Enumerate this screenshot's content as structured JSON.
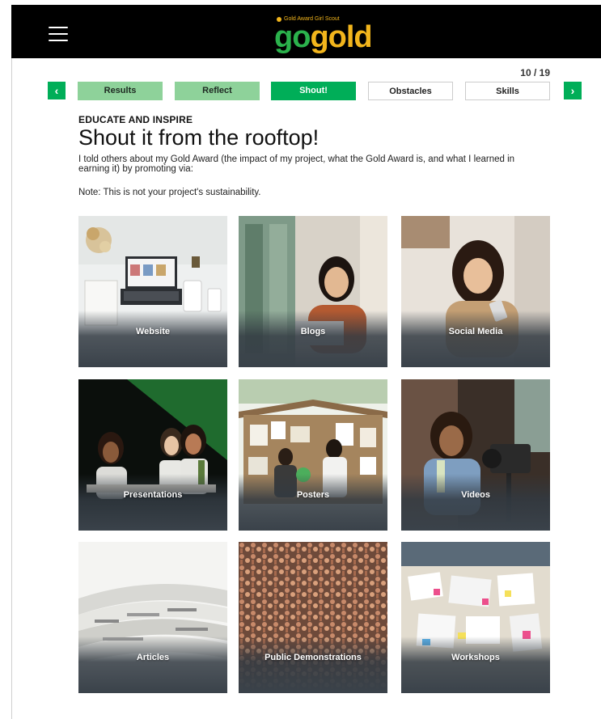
{
  "header": {
    "logo_tagline": "Gold Award Girl Scout",
    "logo_go": "go",
    "logo_gold": "gold"
  },
  "progress": {
    "counter": "10 / 19"
  },
  "steps": [
    {
      "label": "Results",
      "state": "done"
    },
    {
      "label": "Reflect",
      "state": "done"
    },
    {
      "label": "Shout!",
      "state": "active"
    },
    {
      "label": "Obstacles",
      "state": "todo"
    },
    {
      "label": "Skills",
      "state": "todo"
    }
  ],
  "nav": {
    "prev": "‹",
    "next": "›"
  },
  "content": {
    "eyebrow": "EDUCATE AND INSPIRE",
    "title": "Shout it from the rooftop!",
    "description": "I told others about my Gold Award (the impact of my project, what the Gold Award is, and what I learned in earning it) by promoting via:",
    "note": "Note: This is not your project's sustainability."
  },
  "options": [
    {
      "label": "Website"
    },
    {
      "label": "Blogs"
    },
    {
      "label": "Social Media"
    },
    {
      "label": "Presentations"
    },
    {
      "label": "Posters"
    },
    {
      "label": "Videos"
    },
    {
      "label": "Articles"
    },
    {
      "label": "Public Demonstrations"
    },
    {
      "label": "Workshops"
    }
  ],
  "colors": {
    "brand_green": "#00ae58",
    "done_green": "#8ed29a",
    "logo_gold": "#f2b51c",
    "logo_go": "#2bb24c",
    "header_bg": "#000000"
  }
}
